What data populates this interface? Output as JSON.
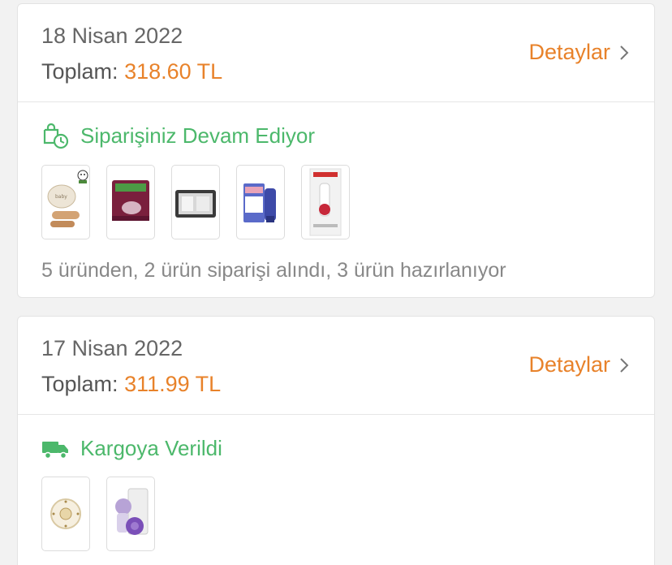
{
  "orders": [
    {
      "date": "18 Nisan 2022",
      "total_label": "Toplam:",
      "total_amount": "318.60 TL",
      "details_label": "Detaylar",
      "status_icon": "bag-clock-icon",
      "status_label": "Siparişiniz Devam Ediyor",
      "status_color": "#4cb86b",
      "products": [
        "brush-set-product",
        "diaper-pack-product",
        "organizer-bag-product",
        "cream-tube-product",
        "bottle-box-product"
      ],
      "summary": "5 üründen, 2 ürün siparişi alındı, 3 ürün hazırlanıyor"
    },
    {
      "date": "17 Nisan 2022",
      "total_label": "Toplam:",
      "total_amount": "311.99 TL",
      "details_label": "Detaylar",
      "status_icon": "truck-icon",
      "status_label": "Kargoya Verildi",
      "status_color": "#4cb86b",
      "products": [
        "pacifier-product",
        "breast-pump-product"
      ]
    }
  ],
  "accent_color": "#e8822a"
}
